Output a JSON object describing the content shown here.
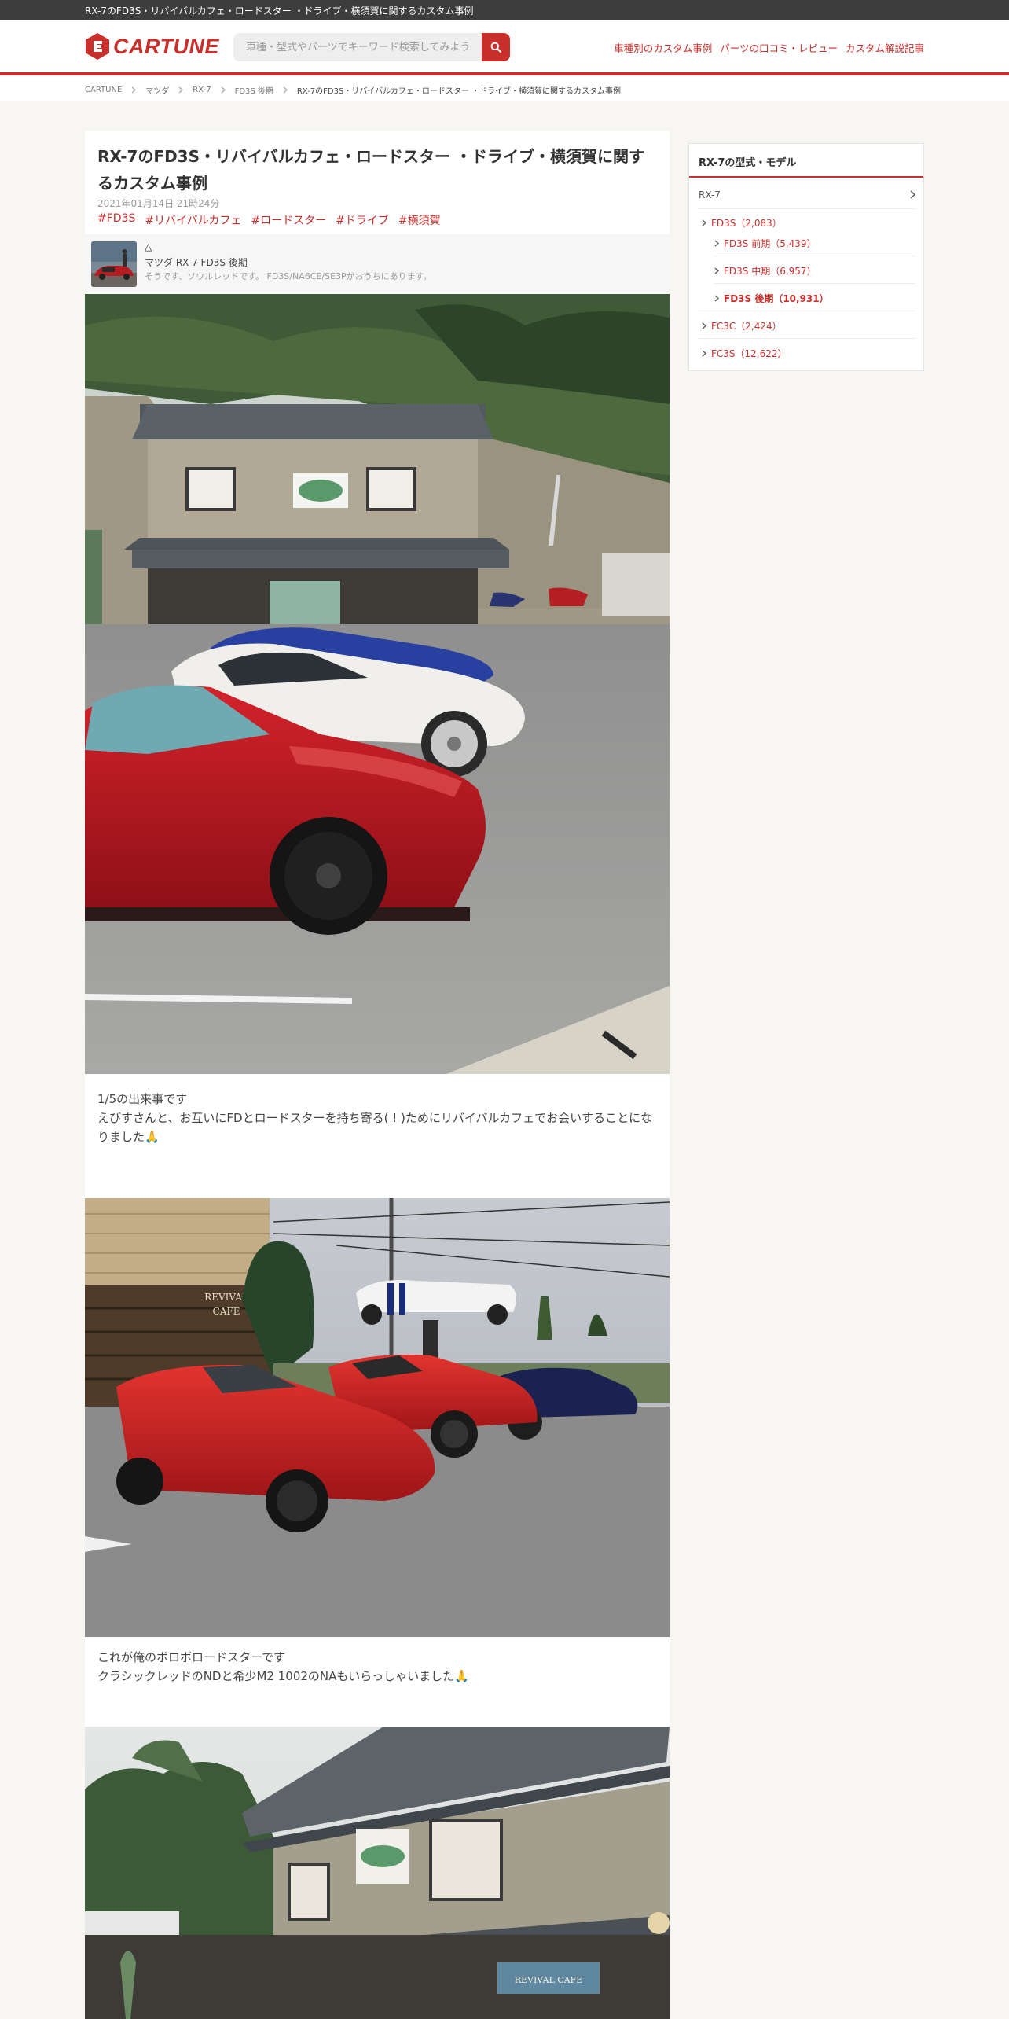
{
  "window": {
    "title": "RX-7のFD3S・リバイバルカフェ・ロードスター ・ドライブ・横須賀に関するカスタム事例"
  },
  "header": {
    "logo_text": "CARTUNE",
    "search_placeholder": "車種・型式やパーツでキーワード検索してみよう",
    "nav": [
      {
        "label": "車種別のカスタム事例"
      },
      {
        "label": "パーツの口コミ・レビュー"
      },
      {
        "label": "カスタム解説記事"
      }
    ]
  },
  "breadcrumb": {
    "items": [
      "CARTUNE",
      "マツダ",
      "RX-7",
      "FD3S 後期"
    ],
    "current": "RX-7のFD3S・リバイバルカフェ・ロードスター ・ドライブ・横須賀に関するカスタム事例"
  },
  "post": {
    "title": "RX-7のFD3S・リバイバルカフェ・ロードスター ・ドライブ・横須賀に関するカスタム事例",
    "date": "2021年01月14日 21時24分",
    "tags": [
      "#FD3S",
      "#リバイバルカフェ",
      "#ロードスター",
      "#ドライブ",
      "#横須賀"
    ],
    "author": {
      "name": "△",
      "car": "マツダ RX-7 FD3S 後期",
      "bio": "そうです、ソウルレッドです。 FD3S/NA6CE/SE3Pがおうちにあります。"
    },
    "captions": [
      [
        "1/5の出来事です",
        "えびすさんと、お互いにFDとロードスターを持ち寄る( ! )ためにリバイバルカフェでお会いすることになりました🙏"
      ],
      [
        "これが俺のボロボロードスターです",
        "クラシックレッドのNDと希少M2 1002のNAもいらっしゃいました🙏"
      ]
    ],
    "sign_text": [
      "REVIVAL",
      "CAFE"
    ],
    "sign_text_2": "REVIVAL CAFE"
  },
  "sidebar": {
    "title": "RX-7の型式・モデル",
    "model": "RX-7",
    "items": [
      {
        "label": "FD3S（2,083）",
        "level": 1
      },
      {
        "label": "FD3S 前期（5,439）",
        "level": 2
      },
      {
        "label": "FD3S 中期（6,957）",
        "level": 2
      },
      {
        "label": "FD3S 後期（10,931）",
        "level": 2,
        "active": true
      },
      {
        "label": "FC3C（2,424）",
        "level": 1
      },
      {
        "label": "FC3S（12,622）",
        "level": 1
      }
    ]
  },
  "colors": {
    "accent": "#c9302c",
    "topbar": "#3d3d3d",
    "background": "#f7f6f3"
  },
  "icons": [
    "logo-mark-icon",
    "search-icon",
    "chevron-right-icon"
  ]
}
